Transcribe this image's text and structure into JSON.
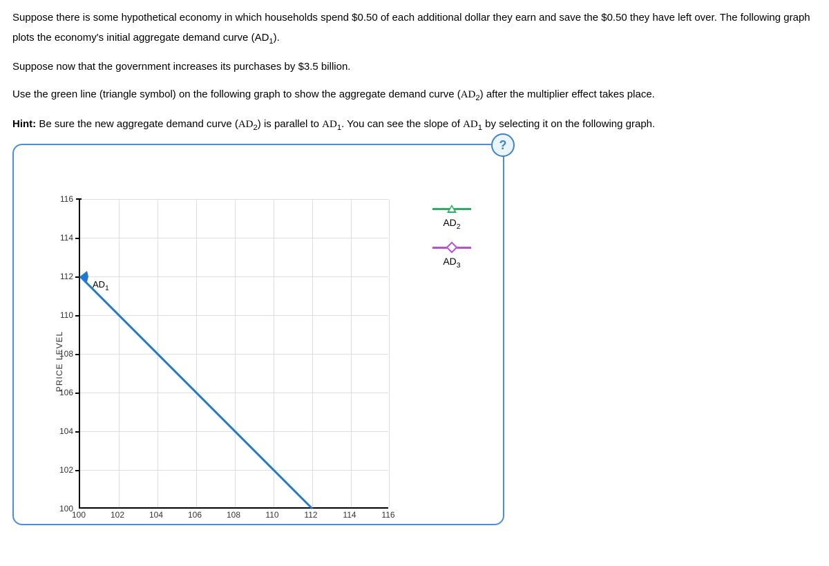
{
  "paragraphs": {
    "p1_a": "Suppose there is some hypothetical economy in which households spend $0.50 of each additional dollar they earn and save the $0.50 they have left over. The following graph plots the economy's initial aggregate demand curve (",
    "p1_ad1": "AD",
    "p1_ad1_sub": "1",
    "p1_b": ").",
    "p2": "Suppose now that the government increases its purchases by $3.5 billion.",
    "p3_a": "Use the green line (triangle symbol) on the following graph to show the aggregate demand curve (",
    "p3_ad2": "AD",
    "p3_ad2_sub": "2",
    "p3_b": ") after the multiplier effect takes place.",
    "p4_hint": "Hint:",
    "p4_a": " Be sure the new aggregate demand curve (",
    "p4_ad2": "AD",
    "p4_ad2_sub": "2",
    "p4_b": ") is parallel to ",
    "p4_ad1a": "AD",
    "p4_ad1a_sub": "1",
    "p4_c": ". You can see the slope of ",
    "p4_ad1b": "AD",
    "p4_ad1b_sub": "1",
    "p4_d": " by selecting it on the following graph."
  },
  "help": "?",
  "chart_data": {
    "type": "line",
    "xlabel": "",
    "ylabel": "PRICE LEVEL",
    "x_ticks": [
      100,
      102,
      104,
      106,
      108,
      110,
      112,
      114,
      116
    ],
    "y_ticks": [
      100,
      102,
      104,
      106,
      108,
      110,
      112,
      114,
      116
    ],
    "xlim": [
      100,
      116
    ],
    "ylim": [
      100,
      116
    ],
    "series": [
      {
        "name": "AD1",
        "label_html": "AD<sub>1</sub>",
        "color": "#1f78d1",
        "points": [
          [
            100,
            112
          ],
          [
            112,
            100
          ]
        ]
      }
    ],
    "legend": [
      {
        "name": "AD2",
        "label": "AD",
        "sub": "2",
        "symbol": "triangle",
        "color": "#24b35c"
      },
      {
        "name": "AD3",
        "label": "AD",
        "sub": "3",
        "symbol": "diamond",
        "color": "#b84fd6"
      }
    ],
    "ad1_label": {
      "text": "AD",
      "sub": "1"
    }
  }
}
